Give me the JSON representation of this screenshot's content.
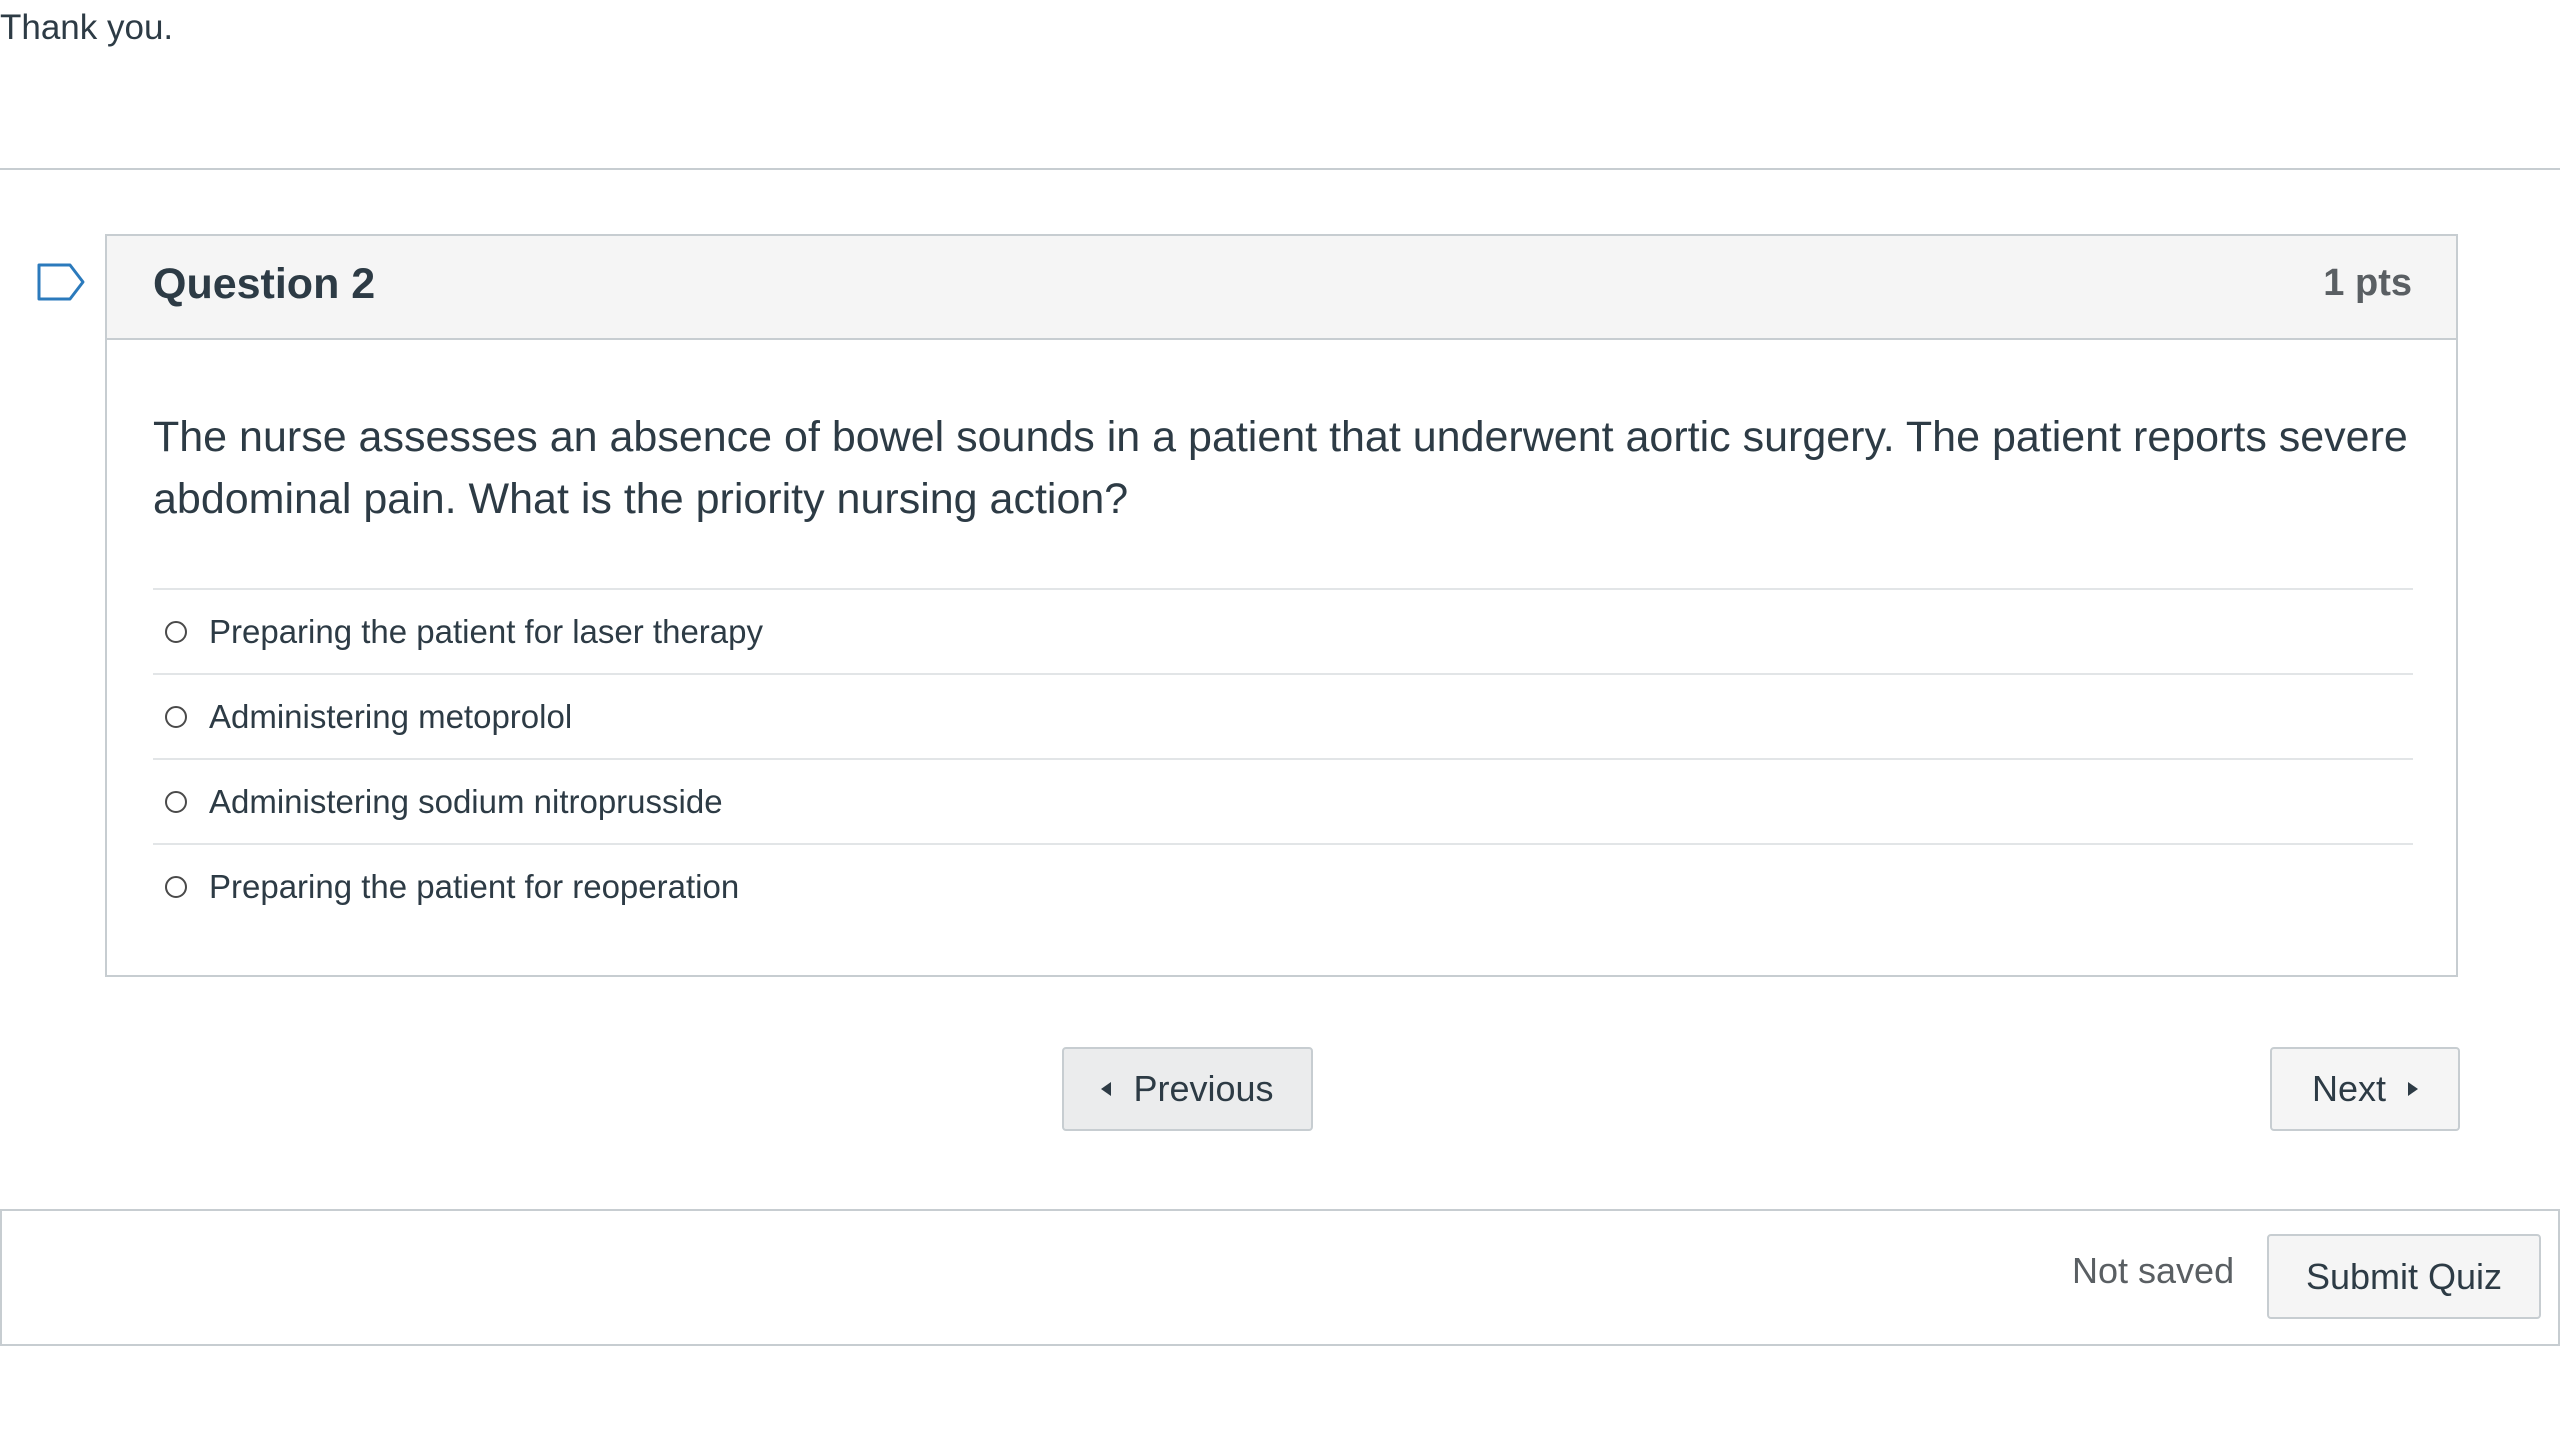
{
  "page": {
    "top_text": "Thank you."
  },
  "question": {
    "title": "Question 2",
    "points": "1 pts",
    "flag_icon": "flag-outline-icon",
    "text": "The nurse assesses an absence of bowel sounds in a patient that underwent aortic surgery. The patient reports severe abdominal pain. What is the priority nursing action?",
    "answers": [
      {
        "label": "Preparing the patient for laser therapy",
        "selected": false
      },
      {
        "label": "Administering metoprolol",
        "selected": false
      },
      {
        "label": "Administering sodium nitroprusside",
        "selected": false
      },
      {
        "label": "Preparing the patient for reoperation",
        "selected": false
      }
    ]
  },
  "navigation": {
    "previous_label": "Previous",
    "next_label": "Next"
  },
  "footer": {
    "status": "Not saved",
    "submit_label": "Submit Quiz"
  },
  "colors": {
    "text": "#2d3b45",
    "border": "#c7cdd1",
    "header_bg": "#f5f5f5"
  }
}
